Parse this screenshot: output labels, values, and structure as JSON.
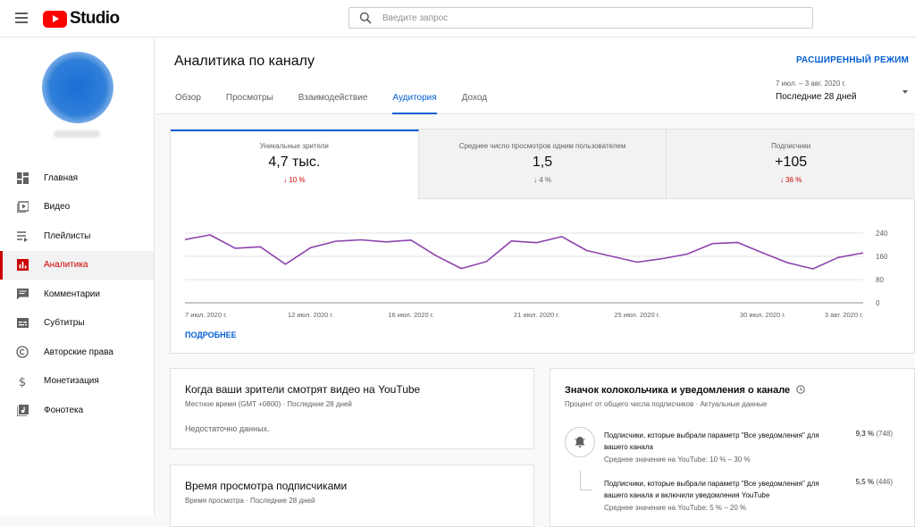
{
  "app": {
    "logo_text": "Studio"
  },
  "search": {
    "placeholder": "Введите запрос"
  },
  "sidebar": {
    "items": [
      {
        "label": "Главная",
        "icon": "dashboard-icon",
        "active": false
      },
      {
        "label": "Видео",
        "icon": "video-icon",
        "active": false
      },
      {
        "label": "Плейлисты",
        "icon": "playlist-icon",
        "active": false
      },
      {
        "label": "Аналитика",
        "icon": "analytics-icon",
        "active": true
      },
      {
        "label": "Комментарии",
        "icon": "comments-icon",
        "active": false
      },
      {
        "label": "Субтитры",
        "icon": "subtitles-icon",
        "active": false
      },
      {
        "label": "Авторские права",
        "icon": "copyright-icon",
        "active": false
      },
      {
        "label": "Монетизация",
        "icon": "dollar-icon",
        "active": false
      },
      {
        "label": "Фонотека",
        "icon": "audio-library-icon",
        "active": false
      }
    ]
  },
  "header": {
    "title": "Аналитика по каналу",
    "advanced_mode": "РАСШИРЕННЫЙ РЕЖИМ",
    "tabs": [
      {
        "label": "Обзор",
        "active": false
      },
      {
        "label": "Просмотры",
        "active": false
      },
      {
        "label": "Взаимодействие",
        "active": false
      },
      {
        "label": "Аудитория",
        "active": true
      },
      {
        "label": "Доход",
        "active": false
      }
    ],
    "date_range": {
      "dates": "7 июл. – 3 авг. 2020 г.",
      "label": "Последние 28 дней"
    }
  },
  "metrics": [
    {
      "label": "Уникальные зрители",
      "value": "4,7 тыс.",
      "delta": "10 %",
      "direction": "down",
      "highlight": "red",
      "active": true
    },
    {
      "label": "Среднее число просмотров одним пользователем",
      "value": "1,5",
      "delta": "4 %",
      "direction": "down",
      "highlight": "gray",
      "active": false
    },
    {
      "label": "Подписчики",
      "value": "+105",
      "delta": "36 %",
      "direction": "down",
      "highlight": "red",
      "active": false
    }
  ],
  "chart_data": {
    "type": "line",
    "x_tick_labels": [
      "7 июл. 2020 г.",
      "12 июл. 2020 г.",
      "16 июл. 2020 г.",
      "21 июл. 2020 г.",
      "25 июл. 2020 г.",
      "30 июл. 2020 г.",
      "3 авг. 2020 г."
    ],
    "x": [
      "7 июл.",
      "8 июл.",
      "9 июл.",
      "10 июл.",
      "11 июл.",
      "12 июл.",
      "13 июл.",
      "14 июл.",
      "15 июл.",
      "16 июл.",
      "17 июл.",
      "18 июл.",
      "19 июл.",
      "20 июл.",
      "21 июл.",
      "22 июл.",
      "23 июл.",
      "24 июл.",
      "25 июл.",
      "26 июл.",
      "27 июл.",
      "28 июл.",
      "29 июл.",
      "30 июл.",
      "31 июл.",
      "1 авг.",
      "2 авг.",
      "3 авг."
    ],
    "series": [
      {
        "values": [
          218,
          234,
          188,
          193,
          133,
          190,
          212,
          217,
          210,
          216,
          162,
          118,
          142,
          213,
          207,
          228,
          180,
          160,
          140,
          152,
          168,
          204,
          208,
          172,
          138,
          117,
          156,
          172
        ]
      }
    ],
    "y_ticks": [
      0,
      80,
      160,
      240
    ],
    "ylim": [
      0,
      240
    ],
    "color": "#8e44ad",
    "grid": true
  },
  "more_link": "ПОДРОБНЕЕ",
  "when_card": {
    "title": "Когда ваши зрители смотрят видео на YouTube",
    "subtitle": "Местное время (GMT +0800) · Последние 28 дней",
    "body": "Недостаточно данных."
  },
  "time_card": {
    "title": "Время просмотра подписчиками",
    "subtitle": "Время просмотра · Последние 28 дней"
  },
  "bell_card": {
    "title": "Значок колокольчика и уведомления о канале",
    "subtitle": "Процент от общего числа подписчиков · Актуальные данные",
    "rows": [
      {
        "text": "Подписчики, которые выбрали параметр \"Все уведомления\" для вашего канала",
        "avg": "Среднее значение на YouTube: 10 % – 30 %",
        "value": "9,3 %",
        "count": "(748)"
      },
      {
        "text": "Подписчики, которые выбрали параметр \"Все уведомления\" для вашего канала и включили уведомления YouTube",
        "avg": "Среднее значение на YouTube: 5 % – 20 %",
        "value": "5,5 %",
        "count": "(446)"
      }
    ]
  },
  "colors": {
    "accent": "#065fd4",
    "brand": "#ff0000",
    "active_nav": "#cc0000",
    "line": "#8e44ad"
  }
}
